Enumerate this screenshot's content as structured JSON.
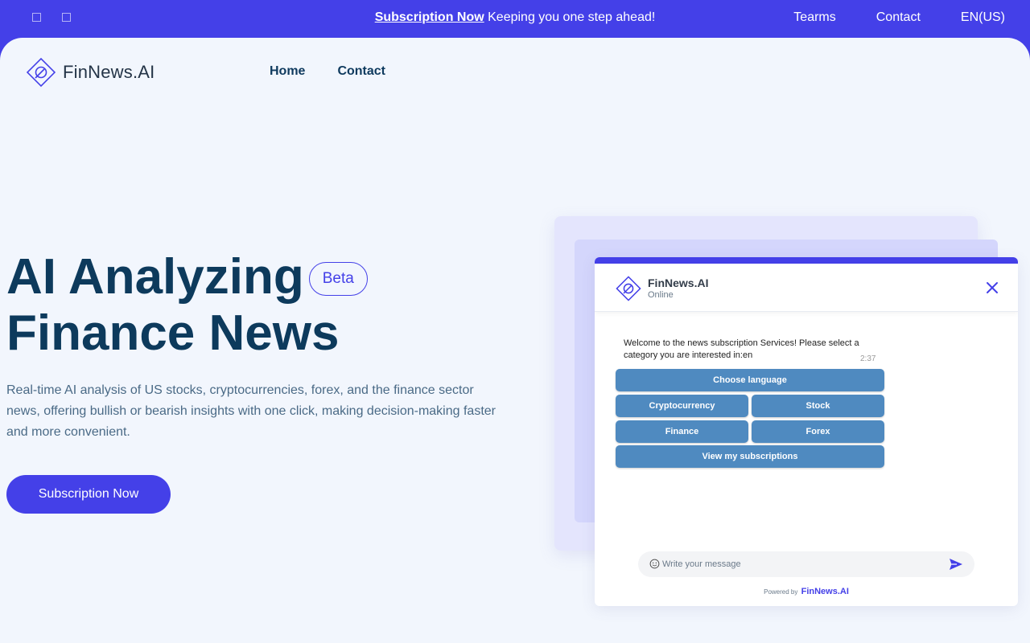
{
  "topbar": {
    "promo_link": "Subscription Now",
    "promo_text": " Keeping you one step ahead!",
    "links": [
      "Tearms",
      "Contact",
      "EN(US)"
    ]
  },
  "header": {
    "logo_text": "FinNews.AI",
    "nav": [
      "Home",
      "Contact"
    ]
  },
  "hero": {
    "title_line1": "AI Analyzing",
    "badge": "Beta",
    "title_line2": "Finance News",
    "description": "Real-time AI analysis of US stocks, cryptocurrencies, forex, and the finance sector news, offering bullish or bearish insights with one click, making decision-making faster and more convenient.",
    "cta": "Subscription Now"
  },
  "chat": {
    "name": "FinNews.AI",
    "status": "Online",
    "message": "Welcome to the news subscription Services! Please select a category you are interested in:en",
    "time": "2:37",
    "options": {
      "language": "Choose language",
      "crypto": "Cryptocurrency",
      "stock": "Stock",
      "finance": "Finance",
      "forex": "Forex",
      "subs": "View my subscriptions"
    },
    "input_placeholder": "Write your message",
    "powered_by": "Powered by",
    "powered_brand": "FinNews.AI"
  },
  "colors": {
    "primary": "#4440e8",
    "background": "#f2f6fd",
    "title": "#0d3a5c",
    "chat_button": "#4f8ac0"
  }
}
